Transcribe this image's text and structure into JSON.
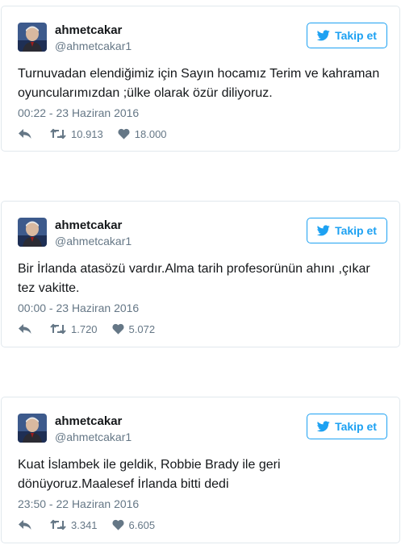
{
  "colors": {
    "accent": "#1da1f2",
    "secondary_text": "#657786",
    "border": "#e1e8ed"
  },
  "tweets": [
    {
      "name": "ahmetcakar",
      "handle": "@ahmetcakar1",
      "follow_label": "Takip et",
      "text": "Turnuvadan elendiğimiz için Sayın hocamız Terim ve kahraman oyuncularımızdan ;ülke olarak özür diliyoruz.",
      "timestamp": "00:22 - 23 Haziran 2016",
      "retweets": "10.913",
      "likes": "18.000"
    },
    {
      "name": "ahmetcakar",
      "handle": "@ahmetcakar1",
      "follow_label": "Takip et",
      "text": "Bir İrlanda atasözü vardır.Alma tarih profesorünün ahını ,çıkar tez vakitte.",
      "timestamp": "00:00 - 23 Haziran 2016",
      "retweets": "1.720",
      "likes": "5.072"
    },
    {
      "name": "ahmetcakar",
      "handle": "@ahmetcakar1",
      "follow_label": "Takip et",
      "text": "Kuat İslambek ile geldik, Robbie Brady ile geri dönüyoruz.Maalesef İrlanda bitti dedi",
      "timestamp": "23:50 - 22 Haziran 2016",
      "retweets": "3.341",
      "likes": "6.605"
    }
  ],
  "icons": {
    "follow": "twitter-bird-icon",
    "reply": "reply-arrow-icon",
    "retweet": "retweet-icon",
    "like": "heart-icon"
  }
}
